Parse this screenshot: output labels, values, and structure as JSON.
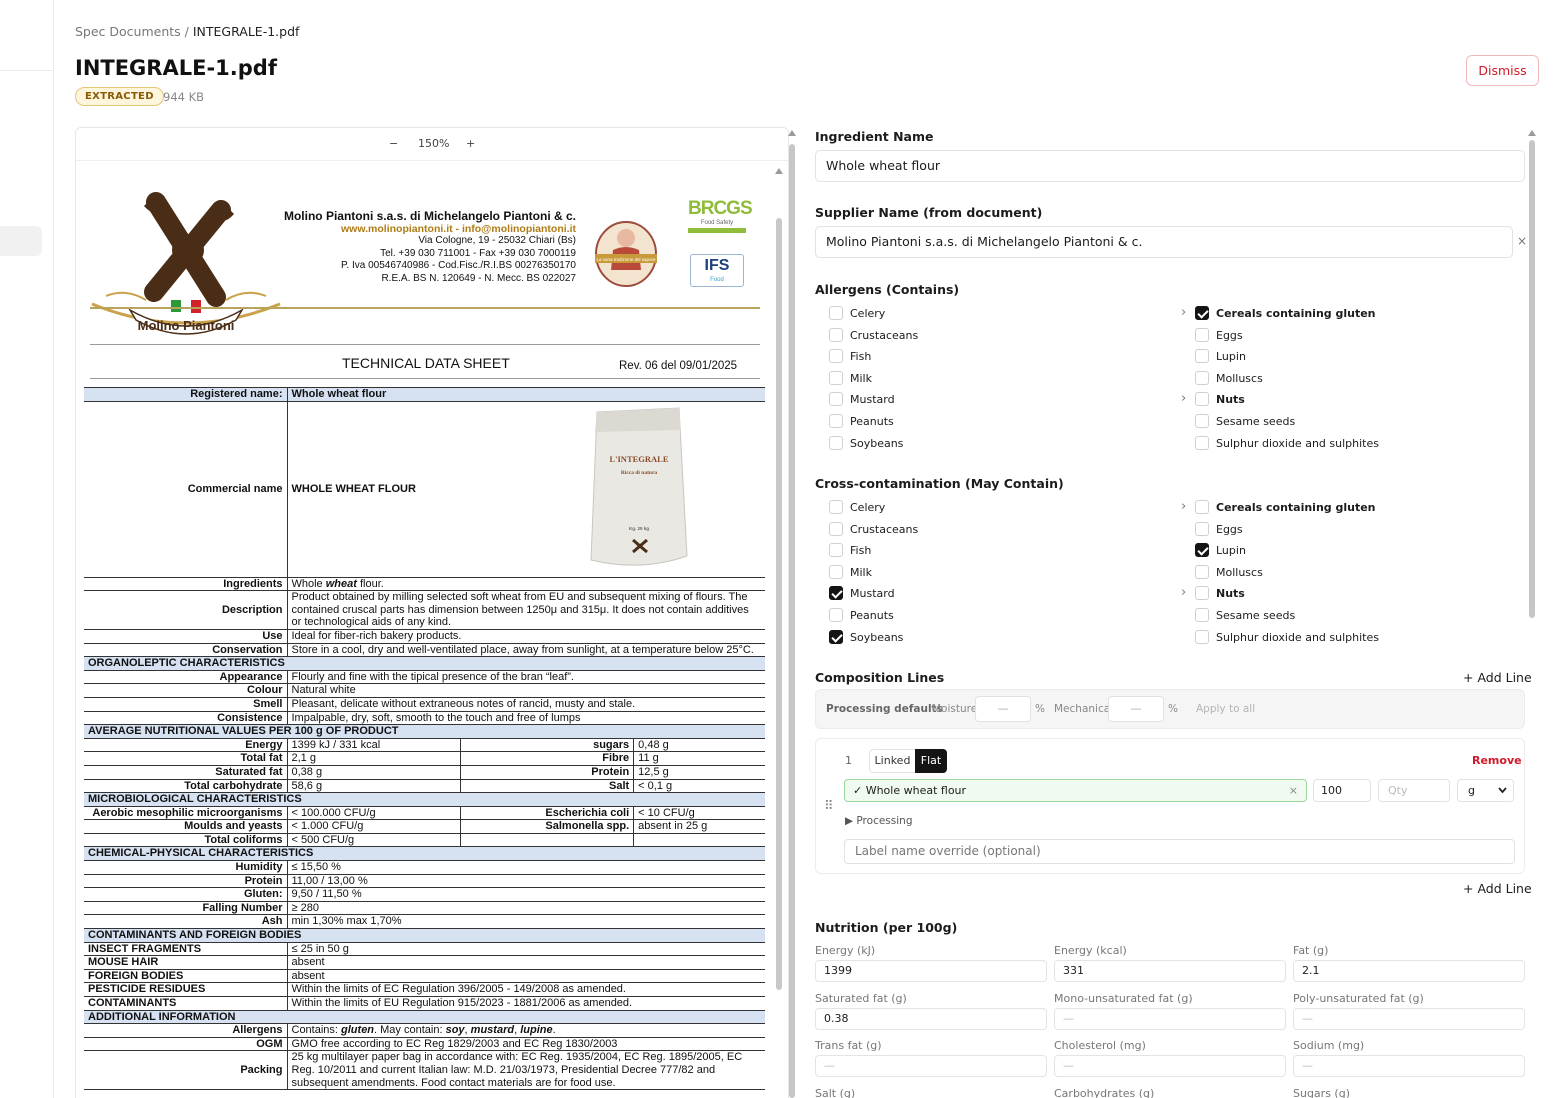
{
  "breadcrumb": {
    "parent": "Spec Documents",
    "sep": " / ",
    "current": "INTEGRALE-1.pdf"
  },
  "document": {
    "title": "INTEGRALE-1.pdf",
    "status": "EXTRACTED",
    "size": "944 KB"
  },
  "actions": {
    "dismiss": "Dismiss"
  },
  "viewer": {
    "zoom_out": "−",
    "zoom": "150%",
    "zoom_in": "+"
  },
  "pdf": {
    "company": "Molino Piantoni s.a.s. di Michelangelo Piantoni & c.",
    "web": "www.molinopiantoni.it - info@molinopiantoni.it",
    "address": "Via Cologne, 19 - 25032 Chiari (Bs)",
    "tel": "Tel. +39 030 711001 - Fax +39 030 7000119",
    "piva": "P. Iva 00546740986 - Cod.Fisc./R.I.BS 00276350170",
    "rea": "R.E.A. BS N. 120649 - N. Mecc. BS 022027",
    "logo_text": "Molino Piantoni",
    "badge_text": "La sana tradizione del sapore",
    "brcgs": "BRCGS",
    "brcgs_sub": "Food Safety",
    "ifs": "IFS",
    "ifs_sub": "Food",
    "bag_brand": "L'INTEGRALE",
    "bag_sub": "Ricca di natura",
    "bag_kg": "Kg. 25 kg",
    "heading": "TECHNICAL DATA SHEET",
    "rev": "Rev. 06 del 09/01/2025",
    "rows": {
      "registered_k": "Registered name:",
      "registered_v": "Whole wheat flour",
      "commercial_k": "Commercial name",
      "commercial_v": "WHOLE WHEAT FLOUR",
      "ingredients_k": "Ingredients",
      "ingredients_v1": "Whole ",
      "ingredients_v2": "wheat",
      "ingredients_v3": " flour.",
      "description_k": "Description",
      "description_v": "Product obtained by milling selected soft wheat from EU and subsequent mixing of flours. The contained cruscal parts has dimension between 1250μ and 315μ. It does not contain additives or technological aids of any kind.",
      "use_k": "Use",
      "use_v": "Ideal for fiber-rich bakery products.",
      "conservation_k": "Conservation",
      "conservation_v": "Store in a cool, dry and well-ventilated place, away from sunlight, at a temperature below 25°C.",
      "organo_h": "ORGANOLEPTIC CHARACTERISTICS",
      "appearance_k": "Appearance",
      "appearance_v": "Flourly and fine with the tipical presence of the bran “leaf”.",
      "colour_k": "Colour",
      "colour_v": "Natural white",
      "smell_k": "Smell",
      "smell_v": "Pleasant, delicate without extraneous notes of rancid, musty and stale.",
      "consistence_k": "Consistence",
      "consistence_v": "Impalpable, dry, soft, smooth to the touch and free of lumps",
      "nutri_h": "AVERAGE NUTRITIONAL VALUES PER 100 g OF PRODUCT",
      "energy_k": "Energy",
      "energy_v": "1399 kJ / 331 kcal",
      "sugars_k": "sugars",
      "sugars_v": "0,48 g",
      "totalfat_k": "Total fat",
      "totalfat_v": "2,1 g",
      "fibre_k": "Fibre",
      "fibre_v": "11 g",
      "satfat_k": "Saturated fat",
      "satfat_v": "0,38 g",
      "protein_k": "Protein",
      "protein_v": "12,5 g",
      "carb_k": "Total carbohydrate",
      "carb_v": "58,6 g",
      "salt_k": "Salt",
      "salt_v": "< 0,1 g",
      "micro_h": "MICROBIOLOGICAL CHARACTERISTICS",
      "aerobic_k": "Aerobic mesophilic microorganisms",
      "aerobic_v": "< 100.000 CFU/g",
      "ecoli_k": "Escherichia coli",
      "ecoli_v": "< 10 CFU/g",
      "moulds_k": "Moulds and yeasts",
      "moulds_v": "< 1.000 CFU/g",
      "salm_k": "Salmonella spp.",
      "salm_v": "absent in 25 g",
      "colif_k": "Total coliforms",
      "colif_v": "< 500 CFU/g",
      "chem_h": "CHEMICAL-PHYSICAL CHARACTERISTICS",
      "humidity_k": "Humidity",
      "humidity_v": "≤ 15,50 %",
      "cprotein_k": "Protein",
      "cprotein_v": "11,00 / 13,00 %",
      "gluten_k": "Gluten:",
      "gluten_v": "9,50 / 11,50 %",
      "falling_k": "Falling Number",
      "falling_v": "≥ 280",
      "ash_k": "Ash",
      "ash_v": "min 1,30% max 1,70%",
      "contam_h": "CONTAMINANTS AND FOREIGN BODIES",
      "insect_k": "INSECT FRAGMENTS",
      "insect_v": "≤ 25 in 50 g",
      "mouse_k": "MOUSE HAIR",
      "mouse_v": "absent",
      "foreign_k": "FOREIGN BODIES",
      "foreign_v": "absent",
      "pest_k": "PESTICIDE RESIDUES",
      "pest_v": "Within the limits of EC Regulation 396/2005 - 149/2008 as amended.",
      "contaminants_k": "CONTAMINANTS",
      "contaminants_v": "Within the limits of EU Regulation 915/2023 - 1881/2006 as amended.",
      "add_h": "ADDITIONAL INFORMATION",
      "allergens_k": "Allergens",
      "allergens_v1": "Contains: ",
      "allergens_v2": "gluten",
      "allergens_v3": ". May contain: ",
      "allergens_v4": "soy",
      "allergens_v5": ", ",
      "allergens_v6": "mustard",
      "allergens_v7": ", ",
      "allergens_v8": "lupine",
      "allergens_v9": ".",
      "ogm_k": "OGM",
      "ogm_v": "GMO free according to EC Reg 1829/2003 and EC Reg 1830/2003",
      "packing_k": "Packing",
      "packing_v": "25 kg multilayer paper bag in accordance with: EC Reg. 1935/2004, EC Reg. 1895/2005, EC Reg. 10/2011 and current Italian law: M.D. 21/03/1973, Presidential Decree 777/82 and subsequent amendments. Food contact materials are for food use."
    }
  },
  "form": {
    "ingredient_label": "Ingredient Name",
    "ingredient_value": "Whole wheat flour",
    "supplier_label": "Supplier Name (from document)",
    "supplier_value": "Molino Piantoni s.a.s. di Michelangelo Piantoni & c.",
    "clear": "×",
    "allergens_label": "Allergens (Contains)",
    "cross_label": "Cross-contamination (May Contain)",
    "allergens_left": [
      "Celery",
      "Crustaceans",
      "Fish",
      "Milk",
      "Mustard",
      "Peanuts",
      "Soybeans"
    ],
    "allergens_right": [
      "Cereals containing gluten",
      "Eggs",
      "Lupin",
      "Molluscs",
      "Nuts",
      "Sesame seeds",
      "Sulphur dioxide and sulphites"
    ],
    "contains_checked": {
      "left": [],
      "right": [
        "Cereals containing gluten"
      ]
    },
    "cross_checked": {
      "left": [
        "Mustard",
        "Soybeans"
      ],
      "right": [
        "Lupin"
      ]
    },
    "chevron": "›",
    "composition_label": "Composition Lines",
    "add_line": "+ Add Line",
    "processing_defaults": "Processing defaults",
    "moisture_label": "Moisture",
    "moisture_value": "—",
    "pct": "%",
    "mechanical_label": "Mechanical",
    "mechanical_value": "—",
    "apply_all": "Apply to all",
    "line_no": "1",
    "linked": "Linked",
    "flat": "Flat",
    "remove": "Remove",
    "line_ingredient": "✓ Whole wheat flour",
    "line_amount": "100",
    "qty_placeholder": "Qty",
    "unit": "g",
    "processing": "▶  Processing",
    "label_override_placeholder": "Label name override (optional)",
    "drag": "⠿",
    "nutrition_label": "Nutrition (per 100g)",
    "nutrition": [
      {
        "label": "Energy (kJ)",
        "value": "1399"
      },
      {
        "label": "Energy (kcal)",
        "value": "331"
      },
      {
        "label": "Fat (g)",
        "value": "2.1"
      },
      {
        "label": "Saturated fat (g)",
        "value": "0.38"
      },
      {
        "label": "Mono-unsaturated fat (g)",
        "value": "—"
      },
      {
        "label": "Poly-unsaturated fat (g)",
        "value": "—"
      },
      {
        "label": "Trans fat (g)",
        "value": "—"
      },
      {
        "label": "Cholesterol (mg)",
        "value": "—"
      },
      {
        "label": "Sodium (mg)",
        "value": "—"
      },
      {
        "label": "Salt (g)",
        "value": ""
      },
      {
        "label": "Carbohydrates (g)",
        "value": ""
      },
      {
        "label": "Sugars (g)",
        "value": ""
      }
    ]
  },
  "colors": {
    "accent_red": "#d01a2a",
    "badge_bg": "#fdf6dc",
    "section_blue": "#d6e1f1",
    "gold": "#b07c16",
    "green": "#3aa53a"
  }
}
